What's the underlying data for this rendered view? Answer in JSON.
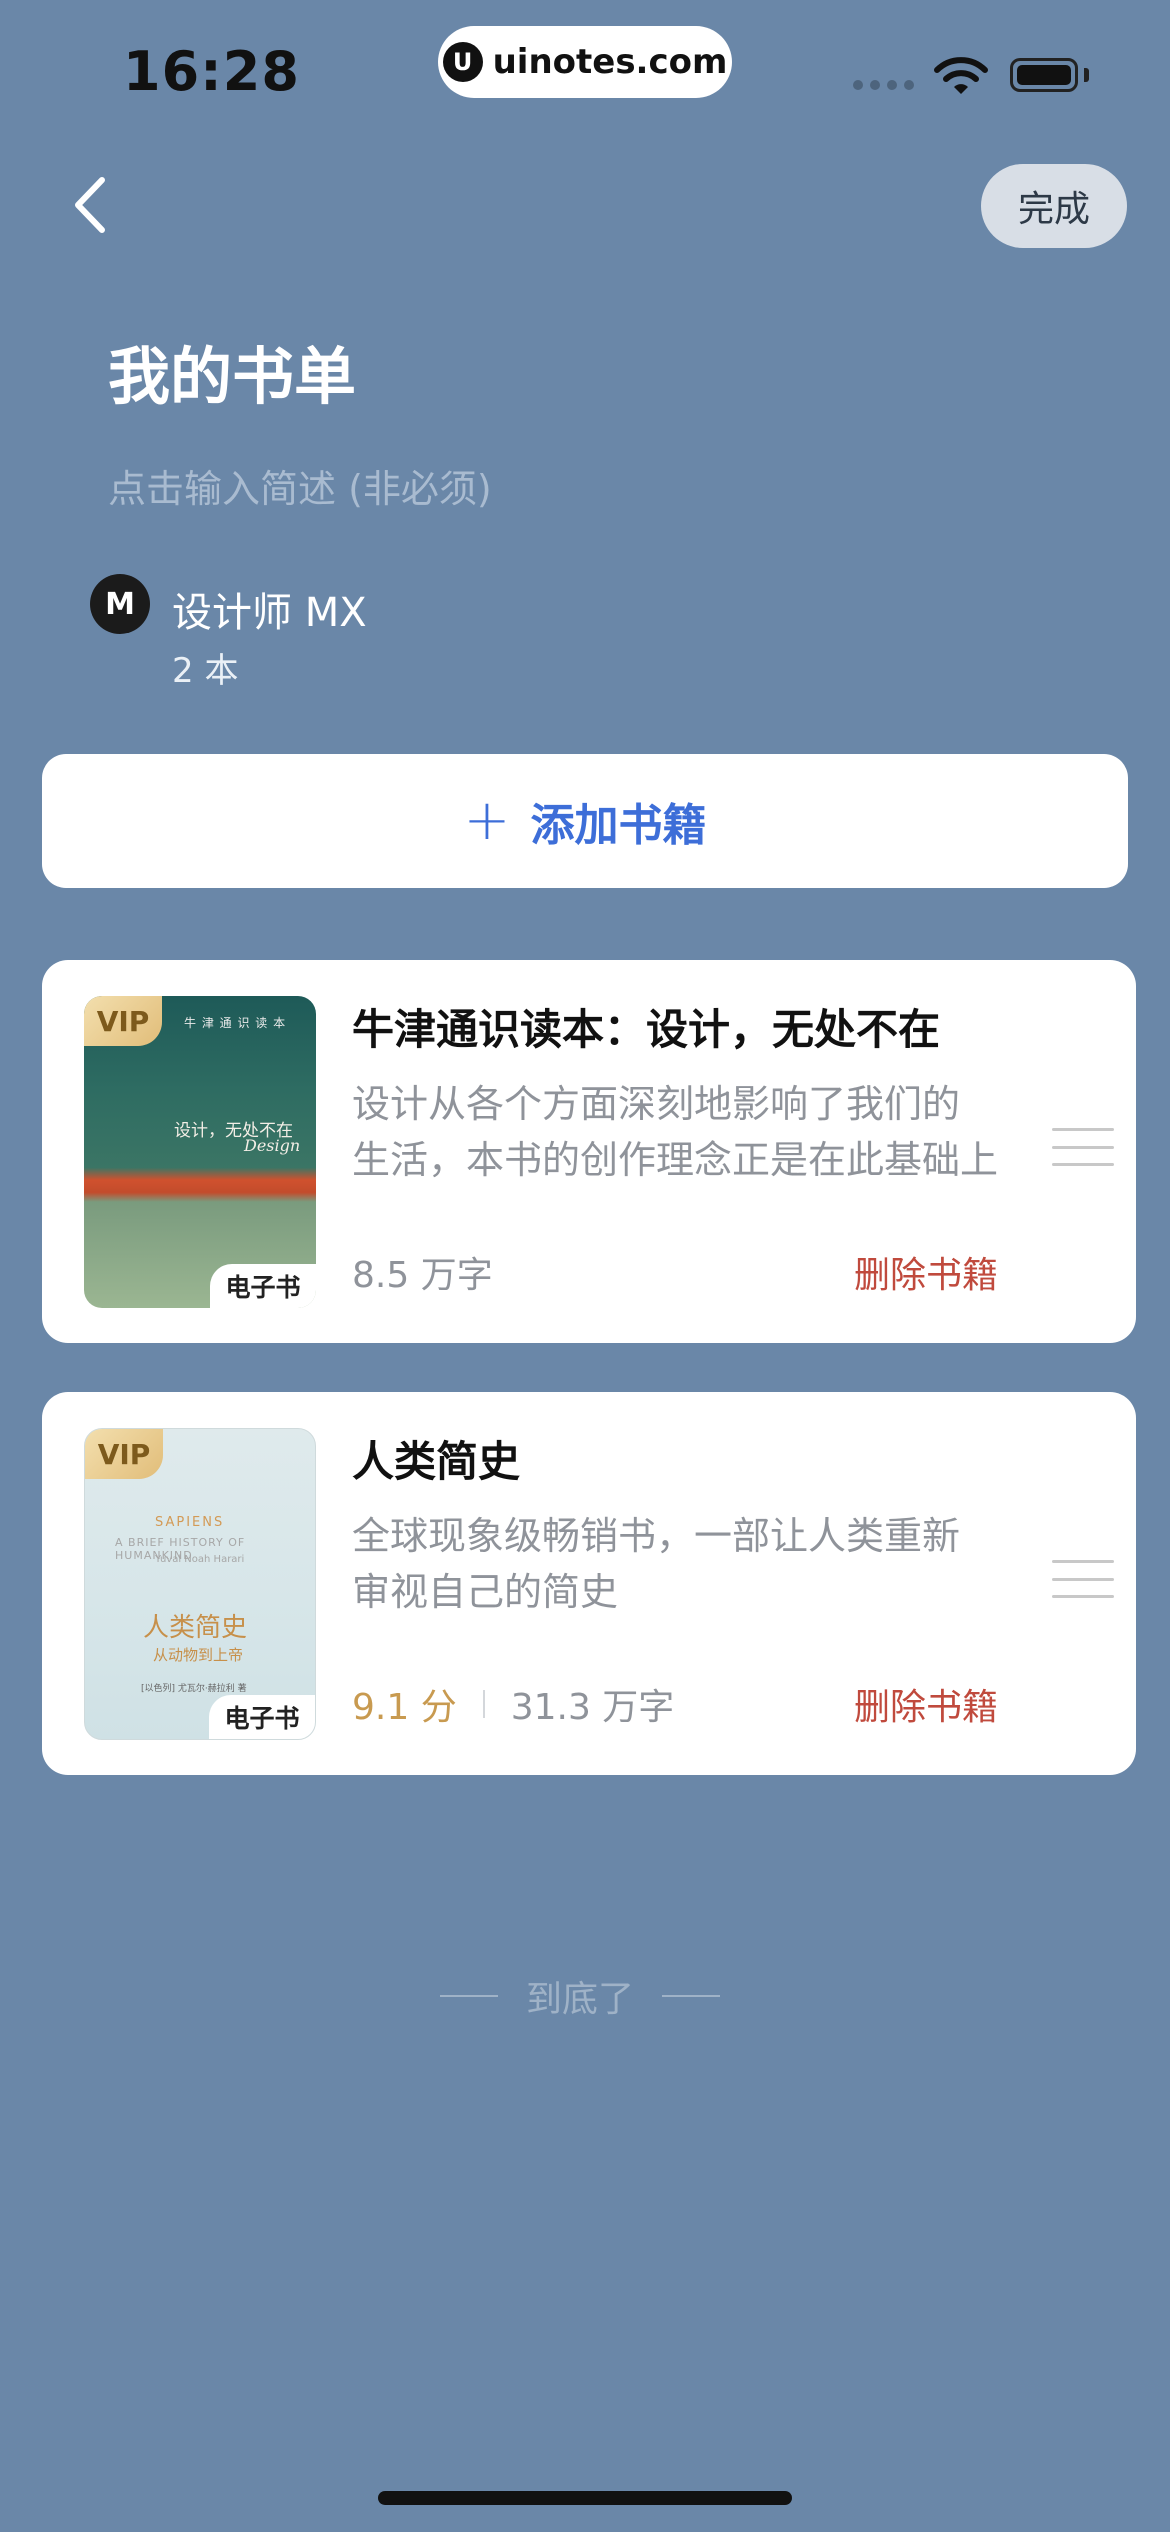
{
  "status_bar": {
    "time": "16:28",
    "url": "uinotes.com",
    "url_logo": "U"
  },
  "header": {
    "done_label": "完成"
  },
  "booklist": {
    "title": "我的书单",
    "description_placeholder": "点击输入简述 (非必须)",
    "author": {
      "avatar_text": "M",
      "name": "设计师 MX",
      "count": "2 本"
    },
    "add_label": "添加书籍"
  },
  "books": [
    {
      "vip": "VIP",
      "tag": "电子书",
      "title": "牛津通识读本：设计，无处不在",
      "desc_line1": "设计从各个方面深刻地影响了我们的",
      "desc_line2": "生活，本书的创作理念正是在此基础上",
      "word_count": "8.5 万字",
      "remove_label": "删除书籍",
      "cover": {
        "top": "牛 津 通 识 读 本",
        "title_cn": "设计，无处不在",
        "title_en": "Design"
      }
    },
    {
      "vip": "VIP",
      "tag": "电子书",
      "title": "人类简史",
      "desc_line1": "全球现象级畅销书，一部让人类重新",
      "desc_line2": "审视自己的简史",
      "rating": "9.1 分",
      "word_count": "31.3 万字",
      "remove_label": "删除书籍",
      "cover": {
        "en1": "SAPIENS",
        "en2": "A BRIEF HISTORY OF HUMANKIND",
        "en3": "Yuval Noah Harari",
        "title_cn": "人类简史",
        "subtitle_cn": "从动物到上帝",
        "author_cn": "[以色列] 尤瓦尔·赫拉利 著"
      }
    }
  ],
  "footer": {
    "end_text": "到底了"
  },
  "colors": {
    "background": "#6a87a8",
    "accent": "#3d6ed8",
    "remove": "#c04a3d",
    "rating": "#c89a50"
  }
}
